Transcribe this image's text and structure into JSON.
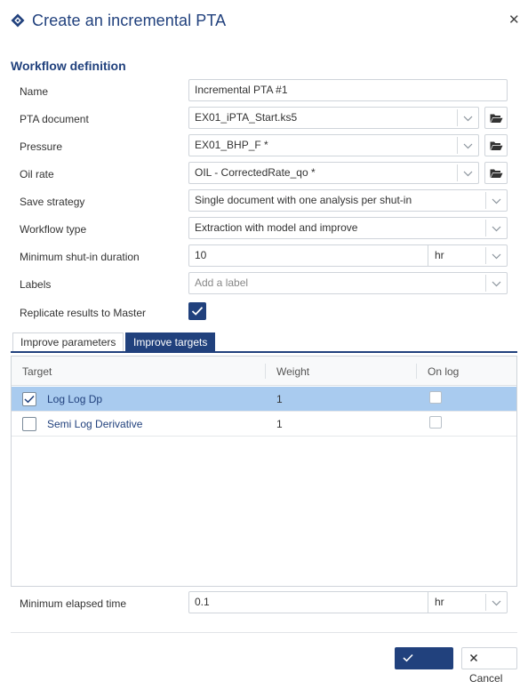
{
  "dialog": {
    "title": "Create an incremental PTA",
    "title_icon": "diamond-nav-icon",
    "close_icon": "close-icon",
    "close_glyph": "✕"
  },
  "workflow": {
    "section_title": "Workflow definition",
    "name": {
      "label": "Name",
      "value": "Incremental PTA #1"
    },
    "pta_document": {
      "label": "PTA document",
      "value": "EX01_iPTA_Start.ks5"
    },
    "pressure": {
      "label": "Pressure",
      "value": "EX01_BHP_F *"
    },
    "oil_rate": {
      "label": "Oil rate",
      "value": "OIL - CorrectedRate_qo *"
    },
    "save_strategy": {
      "label": "Save strategy",
      "value": "Single document with one analysis per shut-in"
    },
    "workflow_type": {
      "label": "Workflow type",
      "value": "Extraction with model and improve"
    },
    "min_shutin": {
      "label": "Minimum shut-in duration",
      "value": "10",
      "unit": "hr"
    },
    "labels": {
      "label": "Labels",
      "placeholder": "Add a label"
    },
    "replicate": {
      "label": "Replicate results to Master",
      "checked": true
    }
  },
  "tabs": [
    {
      "label": "Improve parameters",
      "active": false
    },
    {
      "label": "Improve targets",
      "active": true
    }
  ],
  "targets_table": {
    "headers": [
      "Target",
      "Weight",
      "On log"
    ],
    "rows": [
      {
        "target": "Log Log Dp",
        "weight": "1",
        "checked": true,
        "on_log": false,
        "selected": true
      },
      {
        "target": "Semi Log Derivative",
        "weight": "1",
        "checked": false,
        "on_log": false,
        "selected": false
      }
    ]
  },
  "min_elapsed": {
    "label": "Minimum elapsed time",
    "value": "0.1",
    "unit": "hr"
  },
  "footer": {
    "create_label": "Create",
    "cancel_label": "Cancel"
  },
  "colors": {
    "brand": "#21417d",
    "selected_row": "#a9cbef"
  }
}
